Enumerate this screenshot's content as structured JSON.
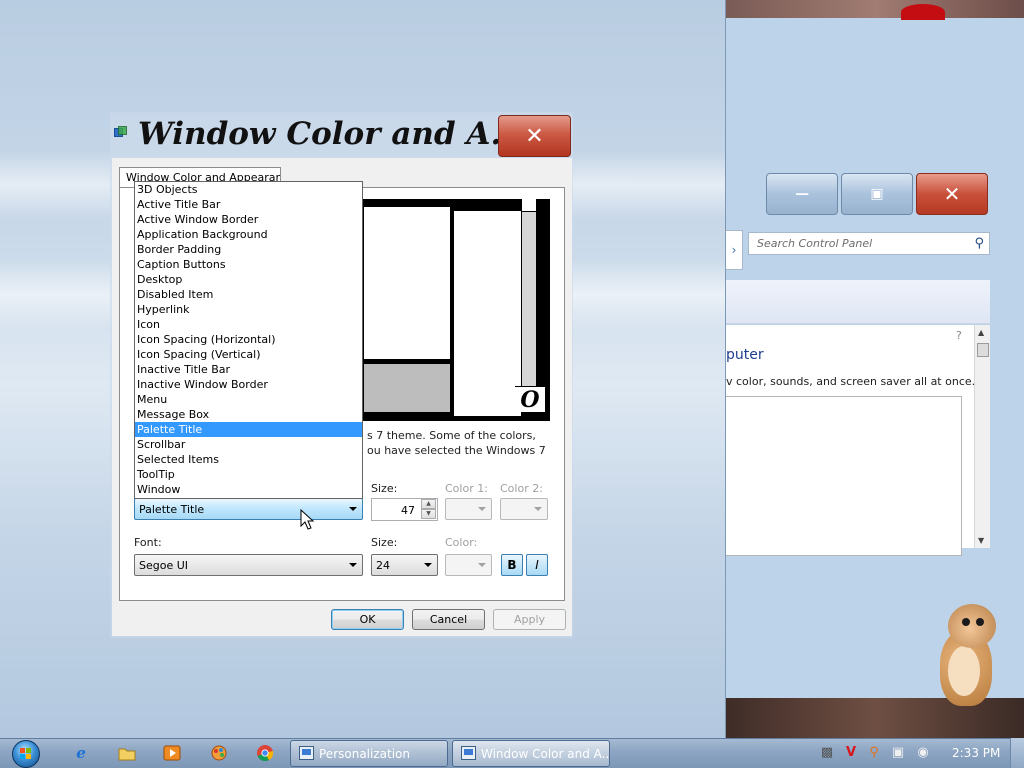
{
  "dialog": {
    "title": "Window Color and A...",
    "tab_label": "Window Color and Appearance",
    "description_line1": "s 7 theme.  Some of the colors,",
    "description_line2": "ou have selected the Windows 7",
    "item_dropdown": {
      "options": [
        "3D Objects",
        "Active Title Bar",
        "Active Window Border",
        "Application Background",
        "Border Padding",
        "Caption Buttons",
        "Desktop",
        "Disabled Item",
        "Hyperlink",
        "Icon",
        "Icon Spacing (Horizontal)",
        "Icon Spacing (Vertical)",
        "Inactive Title Bar",
        "Inactive Window Border",
        "Menu",
        "Message Box",
        "Palette Title",
        "Scrollbar",
        "Selected Items",
        "ToolTip",
        "Window"
      ],
      "selected": "Palette Title"
    },
    "item_size_label": "Size:",
    "item_size_value": "47",
    "color1_label": "Color 1:",
    "color2_label": "Color 2:",
    "font_label": "Font:",
    "font_value": "Segoe UI",
    "font_size_label": "Size:",
    "font_size_value": "24",
    "font_color_label": "Color:",
    "bold_label": "B",
    "italic_label": "I",
    "preview_glyph": "O",
    "buttons": {
      "ok": "OK",
      "cancel": "Cancel",
      "apply": "Apply"
    }
  },
  "background_window": {
    "search_placeholder": "Search Control Panel",
    "heading": "puter",
    "description": "v color, sounds, and screen saver all at once."
  },
  "taskbar": {
    "tasks": [
      {
        "label": "Personalization",
        "active": false
      },
      {
        "label": "Window Color and A...",
        "active": true
      }
    ],
    "clock": "2:33 PM"
  },
  "colors": {
    "selection": "#3399ff",
    "close_button": "#c9503b",
    "taskbar": "#8ea6c3"
  },
  "icons": [
    "app-icon",
    "close-icon",
    "minimize-icon",
    "maximize-icon",
    "search-icon",
    "ie-icon",
    "folder-icon",
    "media-player-icon",
    "chrome-icon"
  ]
}
